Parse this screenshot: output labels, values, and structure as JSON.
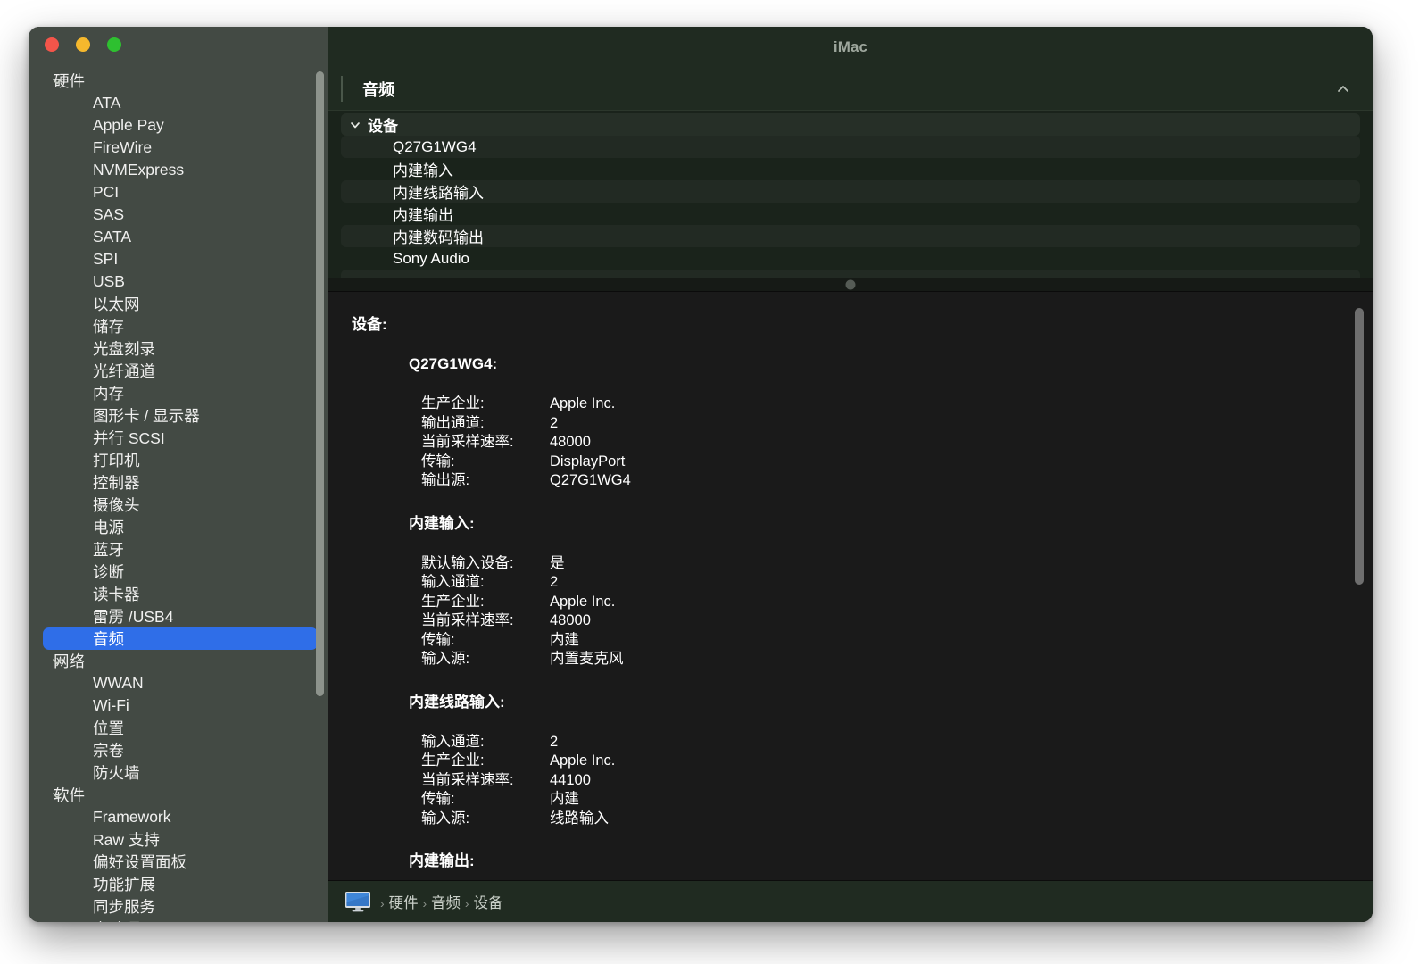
{
  "window": {
    "title": "iMac",
    "traffic_lights": [
      {
        "name": "close",
        "color": "#f4554a"
      },
      {
        "name": "minimize",
        "color": "#f5b82d"
      },
      {
        "name": "maximize",
        "color": "#2ec030"
      }
    ]
  },
  "sidebar": {
    "groups": [
      {
        "label": "硬件",
        "items": [
          "ATA",
          "Apple Pay",
          "FireWire",
          "NVMExpress",
          "PCI",
          "SAS",
          "SATA",
          "SPI",
          "USB",
          "以太网",
          "储存",
          "光盘刻录",
          "光纤通道",
          "内存",
          "图形卡 / 显示器",
          "并行 SCSI",
          "打印机",
          "控制器",
          "摄像头",
          "电源",
          "蓝牙",
          "诊断",
          "读卡器",
          "雷雳 /USB4",
          "音频"
        ],
        "selected": "音频"
      },
      {
        "label": "网络",
        "items": [
          "WWAN",
          "Wi-Fi",
          "位置",
          "宗卷",
          "防火墙"
        ],
        "selected": null
      },
      {
        "label": "软件",
        "items": [
          "Framework",
          "Raw 支持",
          "偏好设置面板",
          "功能扩展",
          "同步服务",
          "启动项"
        ],
        "selected": null
      }
    ],
    "selection_color": "#2f6ee8"
  },
  "section": {
    "title": "音频",
    "collapse_icon": "chevron-up-icon"
  },
  "device_list": {
    "group_label": "设备",
    "group_icon": "chevron-down-icon",
    "items": [
      "Q27G1WG4",
      "内建输入",
      "内建线路输入",
      "内建输出",
      "内建数码输出",
      "Sony Audio"
    ]
  },
  "detail": {
    "root_label": "设备:",
    "groups": [
      {
        "title": "Q27G1WG4:",
        "rows": [
          {
            "key": "生产企业:",
            "value": "Apple Inc."
          },
          {
            "key": "输出通道:",
            "value": "2"
          },
          {
            "key": "当前采样速率:",
            "value": "48000"
          },
          {
            "key": "传输:",
            "value": "DisplayPort"
          },
          {
            "key": "输出源:",
            "value": "Q27G1WG4"
          }
        ]
      },
      {
        "title": "内建输入:",
        "rows": [
          {
            "key": "默认输入设备:",
            "value": "是"
          },
          {
            "key": "输入通道:",
            "value": "2"
          },
          {
            "key": "生产企业:",
            "value": "Apple Inc."
          },
          {
            "key": "当前采样速率:",
            "value": "48000"
          },
          {
            "key": "传输:",
            "value": "内建"
          },
          {
            "key": "输入源:",
            "value": "内置麦克风"
          }
        ]
      },
      {
        "title": "内建线路输入:",
        "rows": [
          {
            "key": "输入通道:",
            "value": "2"
          },
          {
            "key": "生产企业:",
            "value": "Apple Inc."
          },
          {
            "key": "当前采样速率:",
            "value": "44100"
          },
          {
            "key": "传输:",
            "value": "内建"
          },
          {
            "key": "输入源:",
            "value": "线路输入"
          }
        ]
      },
      {
        "title": "内建输出:",
        "rows": []
      }
    ]
  },
  "statusbar": {
    "device_icon": "imac-display-icon",
    "crumbs": [
      "硬件",
      "音频",
      "设备"
    ],
    "separator": "›"
  }
}
